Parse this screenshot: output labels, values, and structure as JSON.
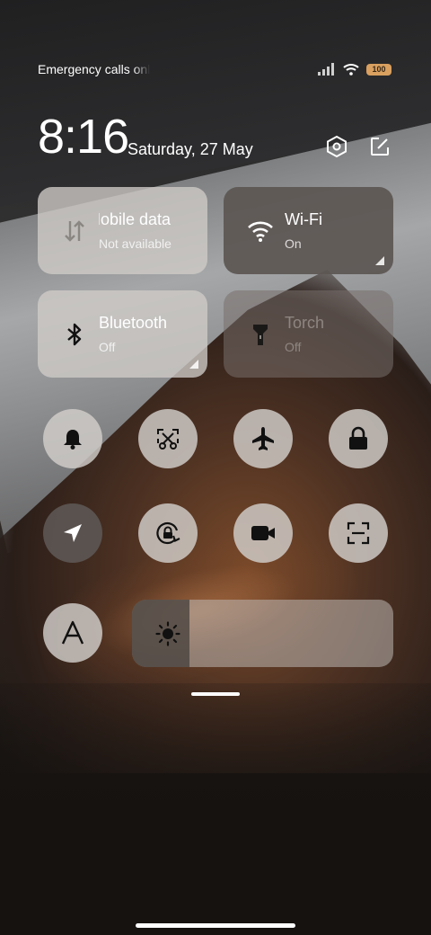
{
  "status_bar": {
    "carrier_text": "Emergency calls only",
    "battery": "100"
  },
  "header": {
    "time": "8:16",
    "date": "Saturday, 27 May",
    "settings_icon": "settings-hex-icon",
    "edit_icon": "edit-icon"
  },
  "tiles": {
    "mobile_data": {
      "title": "Mobile data",
      "subtitle": "Not available",
      "icon": "mobile-data-icon"
    },
    "wifi": {
      "title": "Wi-Fi",
      "subtitle": "On",
      "icon": "wifi-icon"
    },
    "bluetooth": {
      "title": "Bluetooth",
      "subtitle": "Off",
      "icon": "bluetooth-icon"
    },
    "torch": {
      "title": "Torch",
      "subtitle": "Off",
      "icon": "torch-icon"
    }
  },
  "toggles": [
    {
      "name": "bell-icon",
      "active": false
    },
    {
      "name": "screenshot-icon",
      "active": false
    },
    {
      "name": "airplane-icon",
      "active": false
    },
    {
      "name": "lock-icon",
      "active": false
    },
    {
      "name": "location-icon",
      "active": true
    },
    {
      "name": "rotation-lock-icon",
      "active": false
    },
    {
      "name": "video-camera-icon",
      "active": false
    },
    {
      "name": "scan-icon",
      "active": false
    },
    {
      "name": "font-a-icon",
      "active": false
    }
  ],
  "brightness": {
    "level_percent": 22,
    "icon": "sun-icon"
  },
  "colors": {
    "tile_light": "#d0ccc8",
    "tile_dark": "#5c5652",
    "battery": "#d9a05f"
  }
}
